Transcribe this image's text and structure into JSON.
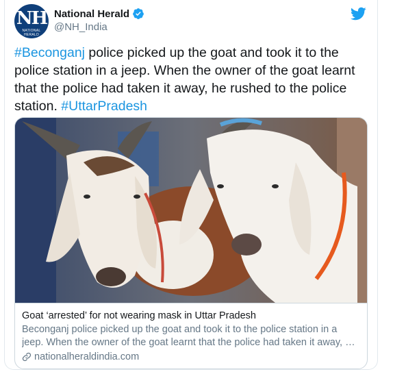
{
  "account": {
    "name": "National Herald",
    "handle": "@NH_India",
    "avatar_initials": "NH",
    "avatar_caption": "NATIONAL HERALD",
    "verified": true
  },
  "tweet": {
    "hashtag1": "#Beconganj",
    "text_main": " police picked up the goat and took it to the police station in a jeep. When the owner of the goat learnt that the police had taken it away, he rushed to the police station. ",
    "hashtag2": "#UttarPradesh"
  },
  "card": {
    "title": "Goat ‘arrested’ for not wearing mask in Uttar Pradesh",
    "description": "Beconganj police picked up the goat and took it to the police station in a jeep. When the owner of the goat learnt that the police had taken it away, he rushed to the police station.",
    "url": "nationalheraldindia.com"
  },
  "icons": {
    "verified": "verified-badge-icon",
    "platform": "twitter-bird-icon",
    "link": "link-icon"
  },
  "colors": {
    "accent": "#1b95e0",
    "twitter_blue": "#1da1f2",
    "secondary_text": "#657786",
    "border": "#ccd6dd"
  }
}
